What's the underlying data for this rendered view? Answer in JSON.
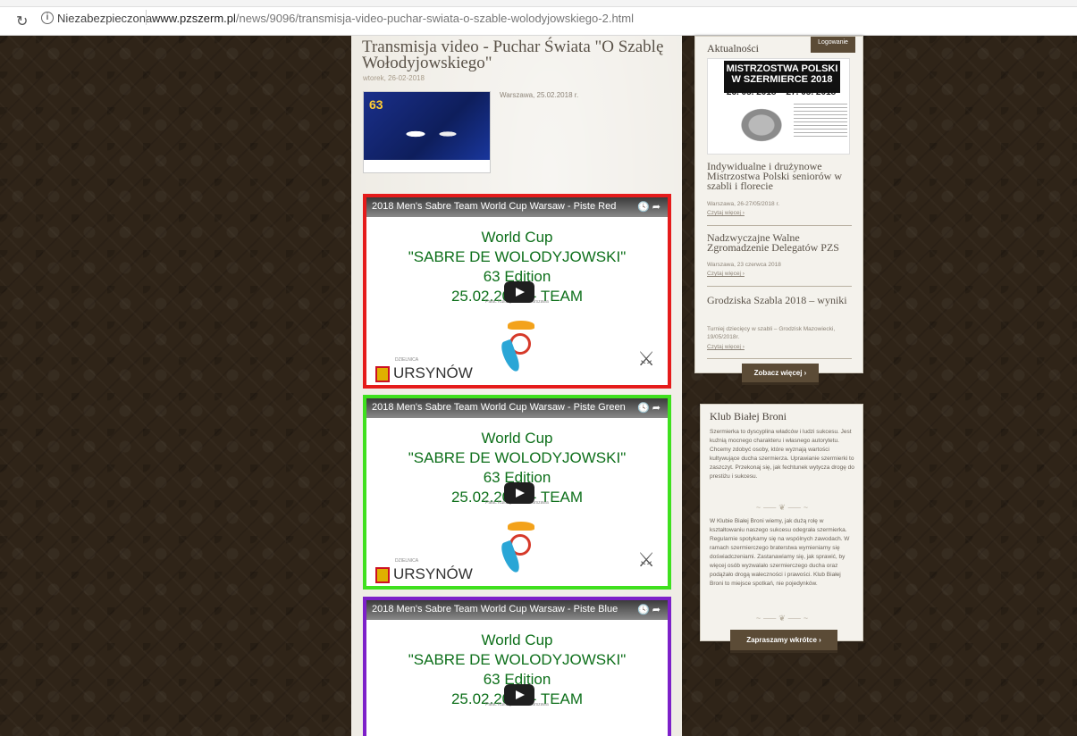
{
  "browser": {
    "security_label": "Niezabezpieczona",
    "url_host": "www.pzszerm.pl",
    "url_path": "/news/9096/transmisja-video-puchar-swiata-o-szable-wolodyjowskiego-2.html"
  },
  "post": {
    "title": "Transmisja video - Puchar Świata \"O Szablę Wołodyjowskiego\"",
    "date": "wtorek, 26-02-2018",
    "thumb_caption": "Warszawa, 25.02.2018 r.",
    "thumb_number": "63"
  },
  "videos": [
    {
      "title": "2018 Men's Sabre Team World Cup Warsaw - Piste Red",
      "line1": "World Cup",
      "line2": "\"SABRE DE WOLODYJOWSKI\"",
      "line3": "63 Edition",
      "line4": "25.02.2018 - TEAM",
      "pin": "Pałac Kultury i Nauki Warszawa",
      "brand": "URSYNÓW",
      "brand_small": "DZIELNICA"
    },
    {
      "title": "2018 Men's Sabre Team World Cup Warsaw - Piste Green",
      "line1": "World Cup",
      "line2": "\"SABRE DE WOLODYJOWSKI\"",
      "line3": "63 Edition",
      "line4": "25.02.2018 - TEAM",
      "pin": "Pałac Kultury i Nauki Warszawa",
      "brand": "URSYNÓW",
      "brand_small": "DZIELNICA"
    },
    {
      "title": "2018 Men's Sabre Team World Cup Warsaw - Piste Blue",
      "line1": "World Cup",
      "line2": "\"SABRE DE WOLODYJOWSKI\"",
      "line3": "63 Edition",
      "line4": "25.02.2018 - TEAM",
      "pin": "Pałac Kultury i Nauki Warszawa"
    }
  ],
  "sidebar": {
    "news_heading": "Aktualności",
    "login_tab": "Logowanie",
    "poster_title": "MISTRZOSTWA POLSKI W SZERMIERCE 2018",
    "poster_dates": "26. 05. 2018 – 27. 05. 2018",
    "news": [
      {
        "title": "Indywidualne i drużynowe Mistrzostwa Polski seniorów w szabli i florecie",
        "meta": "Warszawa, 26-27/05/2018 r.",
        "link": "Czytaj więcej ›"
      },
      {
        "title": "Nadzwyczajne Walne Zgromadzenie Delegatów PZS",
        "meta": "Warszawa, 23 czerwca 2018",
        "link": "Czytaj więcej ›"
      },
      {
        "title": "Grodziska Szabla 2018 – wyniki",
        "meta": "Turniej dziecięcy w szabli – Grodzisk Mazowiecki, 19/05/2018r.",
        "link": "Czytaj więcej ›"
      }
    ],
    "more_button": "Zobacz więcej ›",
    "club_heading": "Klub Białej Broni",
    "club_p1": "Szermierka to dyscyplina władców i ludzi sukcesu. Jest kuźnią mocnego charakteru i własnego autorytetu. Chcemy zdobyć osoby, które wyznają wartości kultywujące ducha szermierza. Uprawianie szermierki to zaszczyt. Przekonaj się, jak fechtunek wytycza drogę do prestiżu i sukcesu.",
    "club_p2": "W Klubie Białej Broni wiemy, jak dużą rolę w kształtowaniu naszego sukcesu odegrała szermierka. Regularnie spotykamy się na wspólnych zawodach. W ramach szermierczego braterstwa wymieniamy się doświadczeniami. Zastanawiamy się, jak sprawić, by więcej osób wyzwalało szermierczego ducha oraz podążało drogą waleczności i prawości. Klub Białej Broni to miejsce spotkań, nie pojedynków.",
    "invite_button": "Zapraszamy wkrótce ›"
  }
}
